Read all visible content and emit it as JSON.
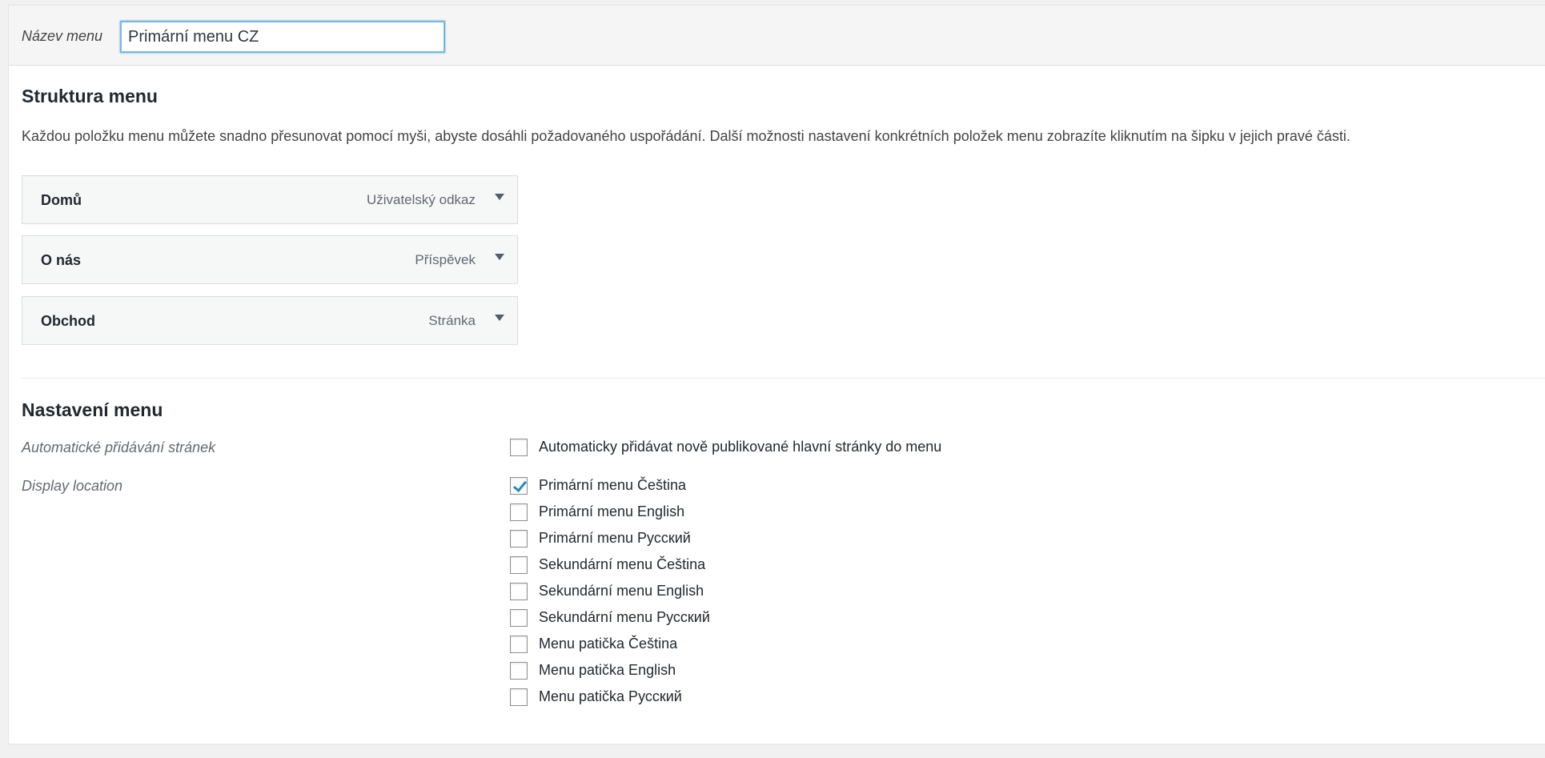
{
  "menu_name": {
    "label": "Název menu",
    "value": "Primární menu CZ"
  },
  "structure": {
    "heading": "Struktura menu",
    "description": "Každou položku menu můžete snadno přesunovat pomocí myši, abyste dosáhli požadovaného uspořádání. Další možnosti nastavení konkrétních položek menu zobrazíte kliknutím na šipku v jejich pravé části.",
    "items": [
      {
        "title": "Domů",
        "type": "Uživatelský odkaz"
      },
      {
        "title": "O nás",
        "type": "Příspěvek"
      },
      {
        "title": "Obchod",
        "type": "Stránka"
      }
    ]
  },
  "settings": {
    "heading": "Nastavení menu",
    "auto_add": {
      "label": "Automatické přidávání stránek",
      "checkbox": {
        "label": "Automaticky přidávat nově publikované hlavní stránky do menu",
        "checked": false
      }
    },
    "display_location": {
      "label": "Display location",
      "options": [
        {
          "label": "Primární menu Čeština",
          "checked": true
        },
        {
          "label": "Primární menu English",
          "checked": false
        },
        {
          "label": "Primární menu Русский",
          "checked": false
        },
        {
          "label": "Sekundární menu Čeština",
          "checked": false
        },
        {
          "label": "Sekundární menu English",
          "checked": false
        },
        {
          "label": "Sekundární menu Русский",
          "checked": false
        },
        {
          "label": "Menu patička Čeština",
          "checked": false
        },
        {
          "label": "Menu patička English",
          "checked": false
        },
        {
          "label": "Menu patička Русский",
          "checked": false
        }
      ]
    }
  },
  "colors": {
    "accent": "#1e8cbe",
    "input_focus_border": "#7eb4e2"
  }
}
